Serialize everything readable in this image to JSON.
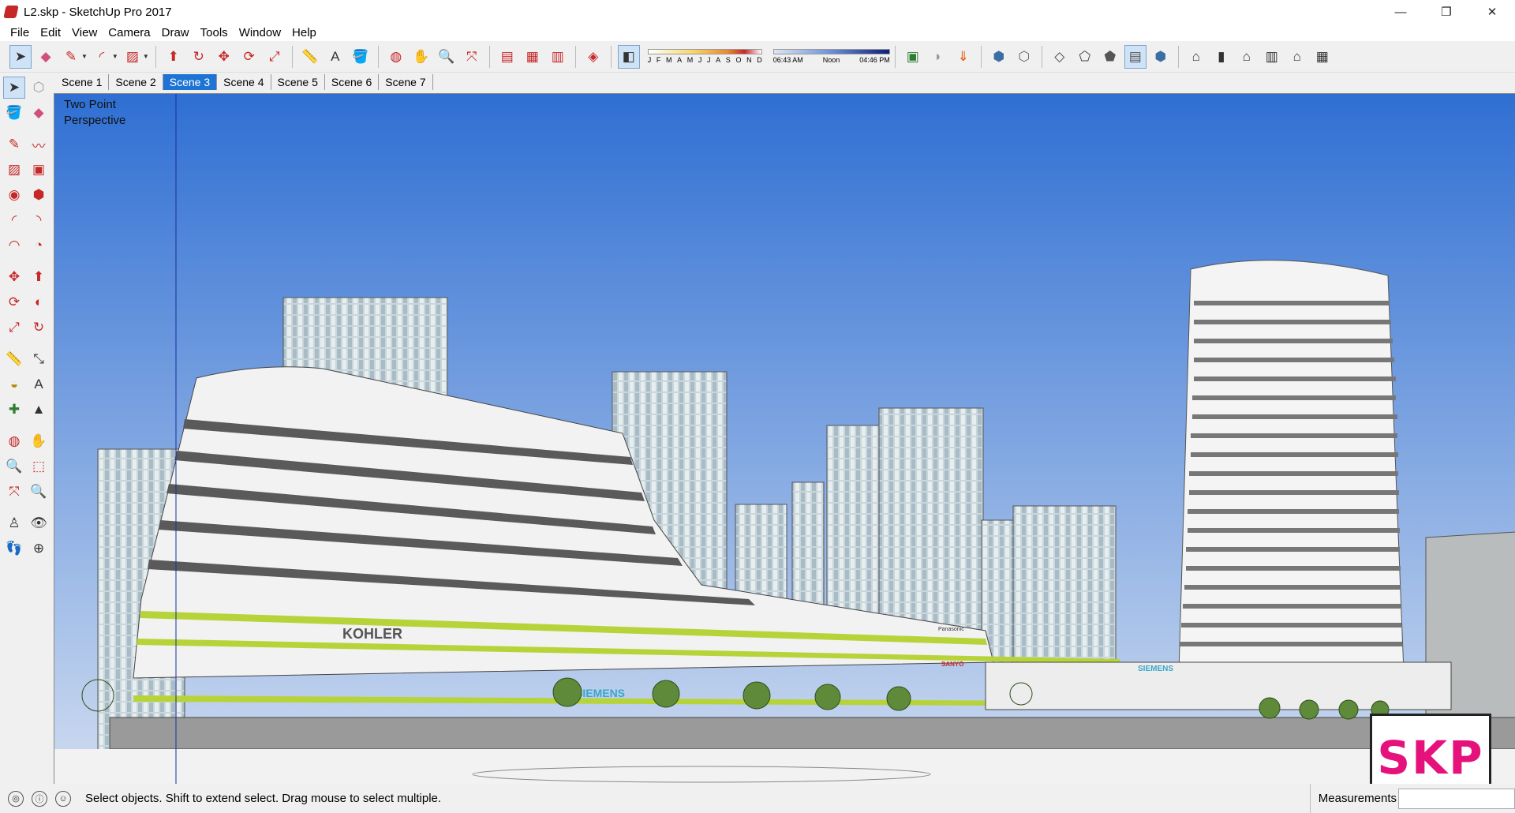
{
  "window": {
    "title": "L2.skp - SketchUp Pro 2017",
    "controls": {
      "minimize": "—",
      "restore": "❐",
      "close": "✕"
    }
  },
  "menu": {
    "items": [
      "File",
      "Edit",
      "View",
      "Camera",
      "Draw",
      "Tools",
      "Window",
      "Help"
    ]
  },
  "toolbar": {
    "shadow": {
      "months": [
        "J",
        "F",
        "M",
        "A",
        "M",
        "J",
        "J",
        "A",
        "S",
        "O",
        "N",
        "D"
      ],
      "time_start": "06:43 AM",
      "time_mid": "Noon",
      "time_end": "04:46 PM"
    }
  },
  "scenes": {
    "tabs": [
      "Scene 1",
      "Scene 2",
      "Scene 3",
      "Scene 4",
      "Scene 5",
      "Scene 6",
      "Scene 7"
    ],
    "active_index": 2
  },
  "viewport": {
    "camera_label_line1": "Two Point",
    "camera_label_line2": "Perspective",
    "sky_top_color": "#2f6fd3",
    "sky_bottom_color": "#cfdcf0",
    "signs": {
      "kohler": "KOHLER",
      "siemens_main": "SIEMENS",
      "panasonic": "Panasonic",
      "sanyo": "SANYO",
      "siemens_right": "SIEMENS"
    }
  },
  "status": {
    "message": "Select objects. Shift to extend select. Drag mouse to select multiple.",
    "measurements_label": "Measurements",
    "measurements_value": ""
  },
  "badge": {
    "text": "SKP",
    "color": "#e6127c"
  }
}
